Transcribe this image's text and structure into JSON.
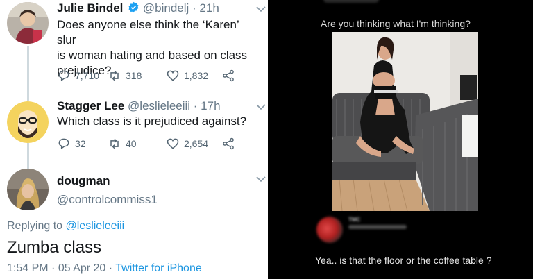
{
  "tweet1": {
    "name": "Julie Bindel",
    "handle": "@bindelj",
    "time": "· 21h",
    "text_lines": [
      "Does anyone else think the ‘Karen’ slur",
      "is woman hating and based on class",
      "prejudice?"
    ],
    "replies": "7,710",
    "retweets": "318",
    "likes": "1,832"
  },
  "tweet2": {
    "name": "Stagger Lee",
    "handle": "@leslieleeiii",
    "time": "· 17h",
    "text": "Which class is it prejudiced against?",
    "replies": "32",
    "retweets": "40",
    "likes": "2,654"
  },
  "tweet3": {
    "name": "dougman",
    "handle": "@controlcommiss1",
    "replying_prefix": "Replying to",
    "replying_to": "@leslieleeiii",
    "text": "Zumba class",
    "time": "1:54 PM",
    "date": "· 05 Apr 20 ·",
    "source": "Twitter for iPhone"
  },
  "right_panel": {
    "caption": "Are you thinking what I'm thinking?",
    "reply_name": "TMC",
    "reply_text": "Yea.. is that the floor or the coffee table ?"
  },
  "colors": {
    "link_blue": "#1b95e0",
    "verified_blue": "#1da1f2",
    "dark_bg": "#000000"
  }
}
